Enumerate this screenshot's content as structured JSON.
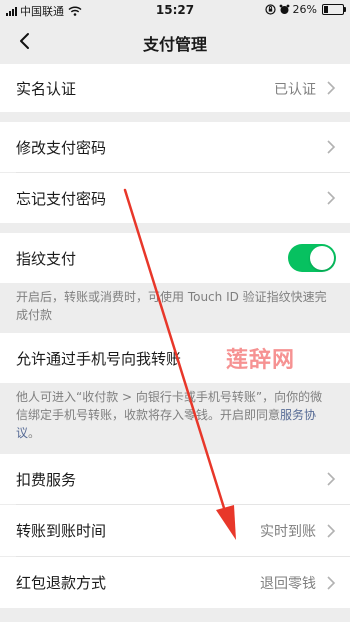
{
  "status_bar": {
    "carrier": "中国联通",
    "time": "15:27",
    "battery": "26%",
    "battery_level": 0.26
  },
  "nav": {
    "title": "支付管理"
  },
  "rows": {
    "real_name": {
      "label": "实名认证",
      "value": "已认证"
    },
    "change_password": {
      "label": "修改支付密码"
    },
    "forgot_password": {
      "label": "忘记支付密码"
    },
    "fingerprint": {
      "label": "指纹支付",
      "enabled": true,
      "description": "开启后，转账或消费时，可使用 Touch ID 验证指纹快速完成付款"
    },
    "phone_transfer": {
      "label": "允许通过手机号向我转账",
      "description": "他人可进入“收付款 > 向银行卡或手机号转账”，向你的微信绑定手机号转账，收款将存入零钱。开启即同意",
      "link": "服务协议",
      "description_end": "。"
    },
    "deduction": {
      "label": "扣费服务"
    },
    "arrival_time": {
      "label": "转账到账时间",
      "value": "实时到账"
    },
    "red_packet_refund": {
      "label": "红包退款方式",
      "value": "退回零钱"
    }
  },
  "watermark": {
    "text": "莲辞网"
  },
  "colors": {
    "accent": "#07c160",
    "link": "#576b95",
    "annotation": "#e8372a"
  }
}
